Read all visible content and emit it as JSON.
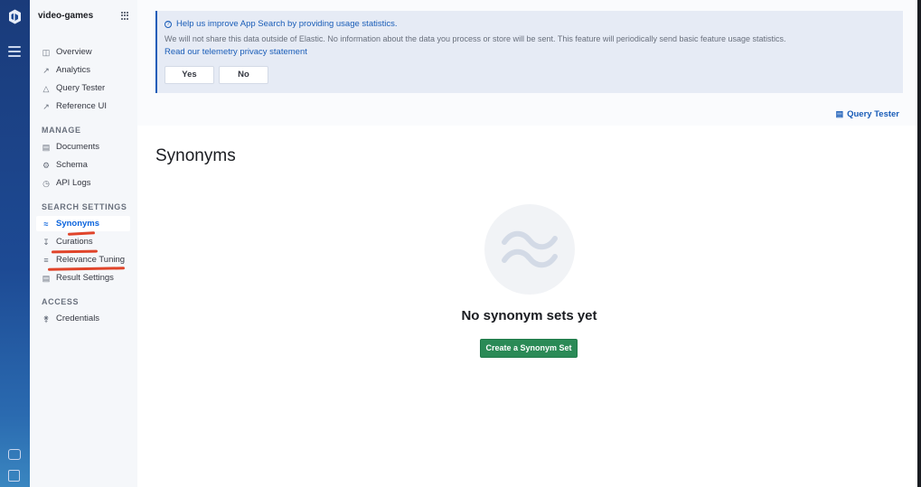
{
  "app": {
    "title": "video-games"
  },
  "sidebar": {
    "top_items": [
      {
        "label": "Overview",
        "icon": "overview-icon"
      },
      {
        "label": "Analytics",
        "icon": "analytics-icon"
      },
      {
        "label": "Query Tester",
        "icon": "flask-icon"
      },
      {
        "label": "Reference UI",
        "icon": "reference-icon"
      }
    ],
    "sections": [
      {
        "title": "MANAGE",
        "items": [
          {
            "label": "Documents",
            "icon": "documents-icon"
          },
          {
            "label": "Schema",
            "icon": "gear-icon"
          },
          {
            "label": "API Logs",
            "icon": "clock-icon"
          }
        ]
      },
      {
        "title": "SEARCH SETTINGS",
        "items": [
          {
            "label": "Synonyms",
            "icon": "synonyms-icon",
            "active": true
          },
          {
            "label": "Curations",
            "icon": "curations-icon"
          },
          {
            "label": "Relevance Tuning",
            "icon": "sliders-icon"
          },
          {
            "label": "Result Settings",
            "icon": "result-settings-icon"
          }
        ]
      },
      {
        "title": "ACCESS",
        "items": [
          {
            "label": "Credentials",
            "icon": "key-icon"
          }
        ]
      }
    ]
  },
  "callout": {
    "title": "Help us improve App Search by providing usage statistics.",
    "body": "We will not share this data outside of Elastic. No information about the data you process or store will be sent. This feature will periodically send basic feature usage statistics.",
    "link": "Read our telemetry privacy statement",
    "yes_label": "Yes",
    "no_label": "No"
  },
  "header": {
    "query_tester_link": "Query Tester"
  },
  "page": {
    "title": "Synonyms",
    "empty_title": "No synonym sets yet",
    "create_button": "Create a Synonym Set"
  },
  "colors": {
    "accent": "#1a5db8",
    "primary_button": "#2a8a56",
    "rail": "#1d4a94",
    "annotation_red": "#e0442a"
  }
}
